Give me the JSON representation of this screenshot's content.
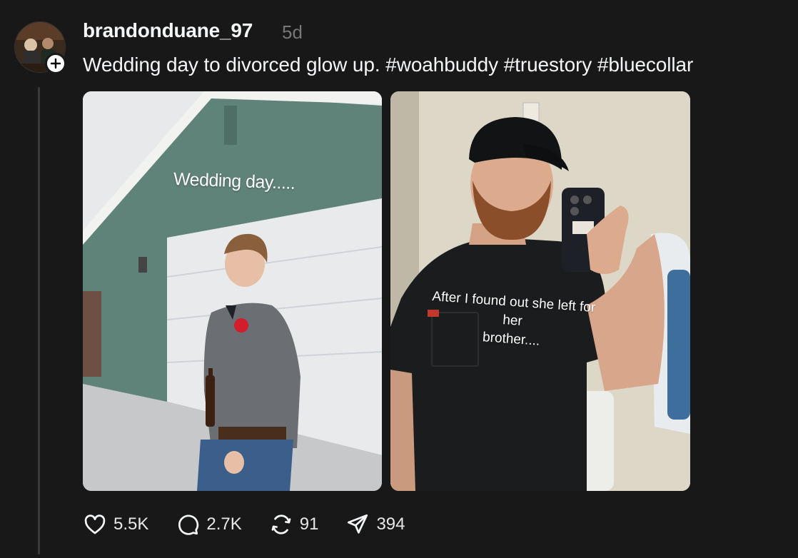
{
  "post": {
    "username": "brandonduane_97",
    "time": "5d",
    "caption": "Wedding day to divorced glow up. #woahbuddy #truestory #bluecollar",
    "images": [
      {
        "overlay_text": "Wedding day....."
      },
      {
        "overlay_text_line1": "After I found out she left for her",
        "overlay_text_line2": "brother...."
      }
    ]
  },
  "actions": {
    "likes": "5.5K",
    "replies": "2.7K",
    "reposts": "91",
    "shares": "394"
  },
  "icons": [
    "plus-icon",
    "heart-icon",
    "comment-icon",
    "repost-icon",
    "share-icon"
  ]
}
